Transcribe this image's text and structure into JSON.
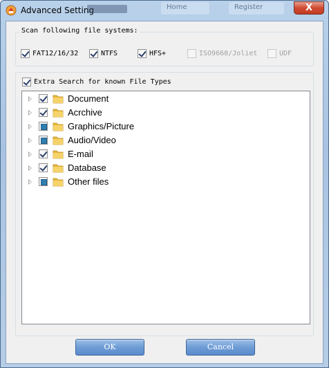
{
  "window": {
    "title": "Advanced Setting",
    "close_glyph": "X",
    "background_menu": [
      "Home",
      "Register"
    ]
  },
  "filesystems": {
    "legend": "Scan following file systems:",
    "items": [
      {
        "label": "FAT12/16/32",
        "checked": true,
        "enabled": true
      },
      {
        "label": "NTFS",
        "checked": true,
        "enabled": true
      },
      {
        "label": "HFS+",
        "checked": true,
        "enabled": true
      },
      {
        "label": "ISO9660/Joliet",
        "checked": false,
        "enabled": false
      },
      {
        "label": "UDF",
        "checked": false,
        "enabled": false
      }
    ]
  },
  "extra_search": {
    "label": "Extra Search for known File Types",
    "checked": true,
    "tree": [
      {
        "label": "Document",
        "state": "checked"
      },
      {
        "label": "Acrchive",
        "state": "checked"
      },
      {
        "label": "Graphics/Picture",
        "state": "partial"
      },
      {
        "label": "Audio/Video",
        "state": "partial"
      },
      {
        "label": "E-mail",
        "state": "checked"
      },
      {
        "label": "Database",
        "state": "checked"
      },
      {
        "label": "Other files",
        "state": "partial"
      }
    ]
  },
  "buttons": {
    "ok": "OK",
    "cancel": "Cancel"
  },
  "colors": {
    "titlebar": "#b9d1ea",
    "button": "#6e9cd5",
    "close": "#cf4b32",
    "folder": "#e8b83a"
  }
}
